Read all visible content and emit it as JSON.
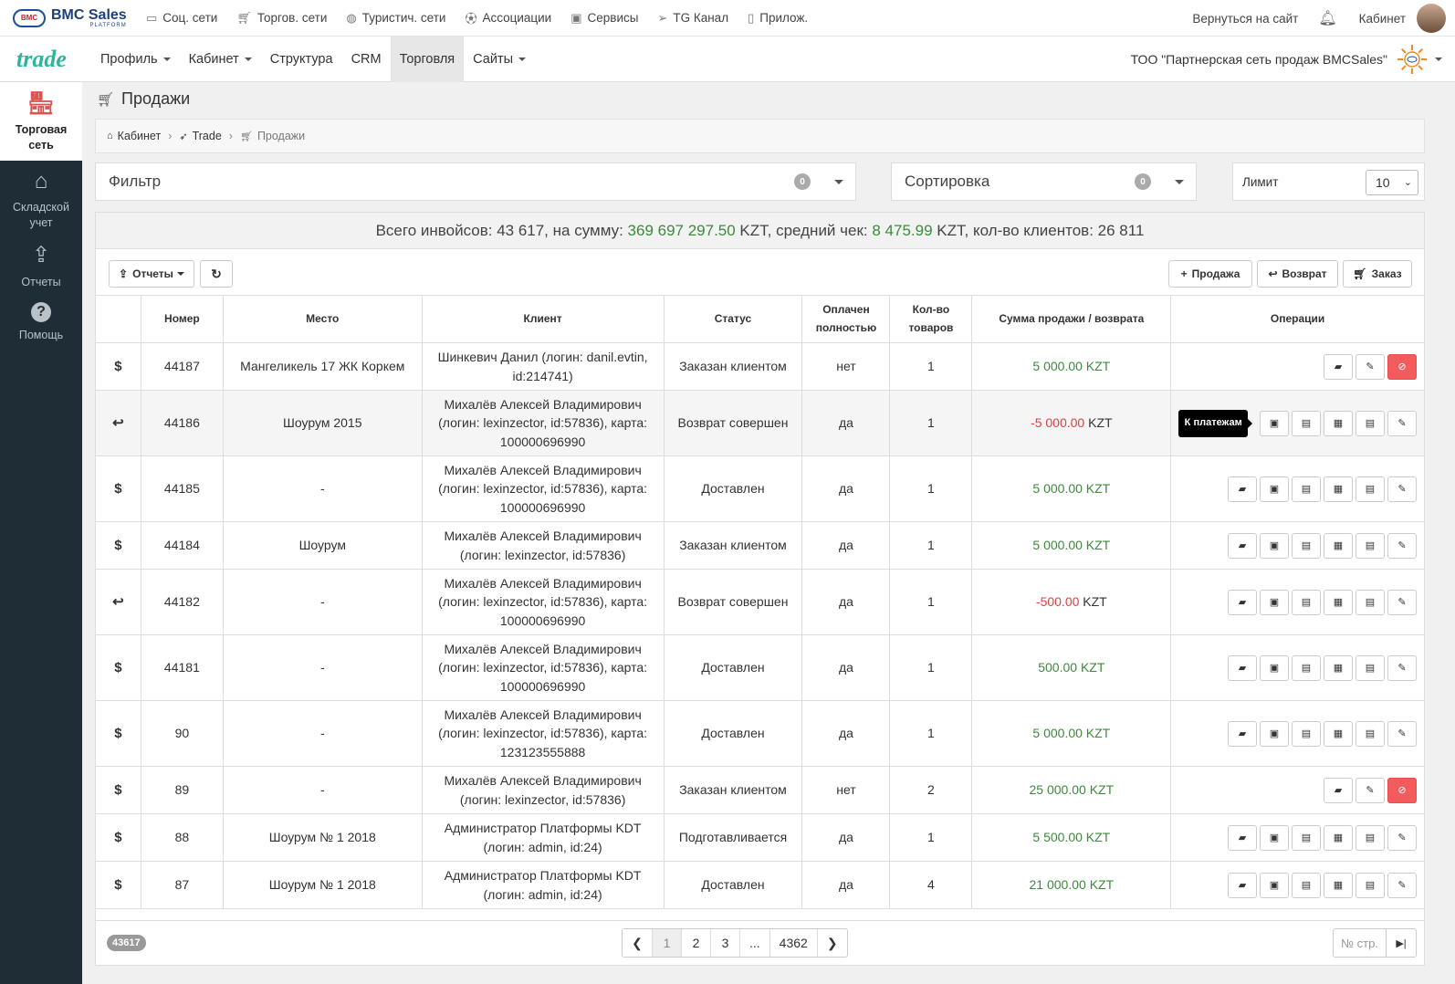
{
  "topbar": {
    "logo_main": "BMC Sales",
    "logo_sub": "PLATFORM",
    "logo_mark": "BMC",
    "links": [
      {
        "label": "Соц. сети",
        "icon": "chat-icon"
      },
      {
        "label": "Торгов. сети",
        "icon": "cart-icon"
      },
      {
        "label": "Туристич. сети",
        "icon": "globe-icon"
      },
      {
        "label": "Ассоциации",
        "icon": "ball-icon"
      },
      {
        "label": "Сервисы",
        "icon": "box-icon"
      },
      {
        "label": "TG Канал",
        "icon": "send-icon"
      },
      {
        "label": "Прилож.",
        "icon": "mobile-icon"
      }
    ],
    "back_link": "Вернуться на сайт",
    "cabinet_link": "Кабинет"
  },
  "navbar": {
    "brand": "trade",
    "items": [
      {
        "label": "Профиль",
        "dropdown": true
      },
      {
        "label": "Кабинет",
        "dropdown": true
      },
      {
        "label": "Структура",
        "dropdown": false
      },
      {
        "label": "CRM",
        "dropdown": false
      },
      {
        "label": "Торговля",
        "dropdown": false,
        "active": true
      },
      {
        "label": "Сайты",
        "dropdown": true
      }
    ],
    "company": "ТОО \"Партнерская сеть продаж BMCSales\""
  },
  "sidebar": {
    "items": [
      {
        "label": "Торговая сеть",
        "icon": "store-icon",
        "active": true
      },
      {
        "label": "Складской учет",
        "icon": "warehouse-icon",
        "active": false
      },
      {
        "label": "Отчеты",
        "icon": "share-icon",
        "active": false
      },
      {
        "label": "Помощь",
        "icon": "help-icon",
        "active": false
      }
    ]
  },
  "page": {
    "title": "Продажи",
    "breadcrumb": [
      "Кабинет",
      "Trade",
      "Продажи"
    ],
    "filter_label": "Фильтр",
    "filter_count": "0",
    "sort_label": "Сортировка",
    "sort_count": "0",
    "limit_label": "Лимит",
    "limit_value": "10"
  },
  "summary": {
    "p1": "Всего инвойсов: 43 617, на сумму: ",
    "sum": "369 697 297.50",
    "p2": " KZT, средний чек: ",
    "avg": "8 475.99",
    "p3": " KZT, кол-во клиентов: 26 811"
  },
  "toolbar": {
    "reports": "Отчеты",
    "sale": "Продажа",
    "return": "Возврат",
    "order": "Заказ"
  },
  "table": {
    "headers": [
      "",
      "Номер",
      "Место",
      "Клиент",
      "Статус",
      "Оплачен полностью",
      "Кол-во товаров",
      "Сумма продажи / возврата",
      "Операции"
    ],
    "rows": [
      {
        "type": "$",
        "num": "44187",
        "place": "Мангеликель 17 ЖК Коркем",
        "client": "Шинкевич Данил (логин: danil.evtin, id:214741)",
        "status": "Заказан клиентом",
        "paid": "нет",
        "qty": "1",
        "amount": "5 000.00",
        "currency": "KZT",
        "neg": false,
        "ops": "short"
      },
      {
        "type": "↩",
        "num": "44186",
        "place": "Шоурум 2015",
        "client": "Михалёв Алексей Владимирович (логин: lexinzector, id:57836), карта: 100000696990",
        "status": "Возврат совершен",
        "paid": "да",
        "qty": "1",
        "amount": "-5 000.00",
        "currency": "KZT",
        "neg": true,
        "ops": "tooltip"
      },
      {
        "type": "$",
        "num": "44185",
        "place": "-",
        "client": "Михалёв Алексей Владимирович (логин: lexinzector, id:57836), карта: 100000696990",
        "status": "Доставлен",
        "paid": "да",
        "qty": "1",
        "amount": "5 000.00",
        "currency": "KZT",
        "neg": false,
        "ops": "full"
      },
      {
        "type": "$",
        "num": "44184",
        "place": "Шоурум",
        "client": "Михалёв Алексей Владимирович (логин: lexinzector, id:57836)",
        "status": "Заказан клиентом",
        "paid": "да",
        "qty": "1",
        "amount": "5 000.00",
        "currency": "KZT",
        "neg": false,
        "ops": "full"
      },
      {
        "type": "↩",
        "num": "44182",
        "place": "-",
        "client": "Михалёв Алексей Владимирович (логин: lexinzector, id:57836), карта: 100000696990",
        "status": "Возврат совершен",
        "paid": "да",
        "qty": "1",
        "amount": "-500.00",
        "currency": "KZT",
        "neg": true,
        "ops": "full"
      },
      {
        "type": "$",
        "num": "44181",
        "place": "-",
        "client": "Михалёв Алексей Владимирович (логин: lexinzector, id:57836), карта: 100000696990",
        "status": "Доставлен",
        "paid": "да",
        "qty": "1",
        "amount": "500.00",
        "currency": "KZT",
        "neg": false,
        "ops": "full"
      },
      {
        "type": "$",
        "num": "90",
        "place": "-",
        "client": "Михалёв Алексей Владимирович (логин: lexinzector, id:57836), карта: 123123555888",
        "status": "Доставлен",
        "paid": "да",
        "qty": "1",
        "amount": "5 000.00",
        "currency": "KZT",
        "neg": false,
        "ops": "full"
      },
      {
        "type": "$",
        "num": "89",
        "place": "-",
        "client": "Михалёв Алексей Владимирович (логин: lexinzector, id:57836)",
        "status": "Заказан клиентом",
        "paid": "нет",
        "qty": "2",
        "amount": "25 000.00",
        "currency": "KZT",
        "neg": false,
        "ops": "short"
      },
      {
        "type": "$",
        "num": "88",
        "place": "Шоурум № 1 2018",
        "client": "Администратор Платформы KDT (логин: admin, id:24)",
        "status": "Подготавливается",
        "paid": "да",
        "qty": "1",
        "amount": "5 500.00",
        "currency": "KZT",
        "neg": false,
        "ops": "full"
      },
      {
        "type": "$",
        "num": "87",
        "place": "Шоурум № 1 2018",
        "client": "Администратор Платформы KDT (логин: admin, id:24)",
        "status": "Доставлен",
        "paid": "да",
        "qty": "4",
        "amount": "21 000.00",
        "currency": "KZT",
        "neg": false,
        "ops": "full"
      }
    ],
    "tooltip": "К платежам"
  },
  "pagination": {
    "total_badge": "43617",
    "pages": [
      "1",
      "2",
      "3",
      "...",
      "4362"
    ],
    "page_field_placeholder": "№ стр."
  }
}
